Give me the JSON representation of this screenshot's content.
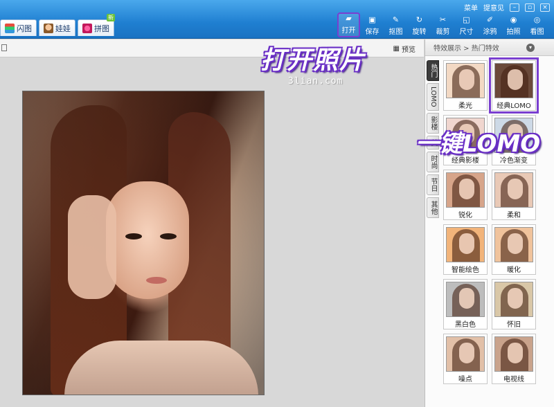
{
  "window": {
    "menu_label": "菜单",
    "feedback_label": "提意见",
    "minimize_icon": "minimize-icon",
    "restore_icon": "restore-icon",
    "close_icon": "close-icon"
  },
  "modules": [
    {
      "label": "闪图",
      "icon": "flash-icon"
    },
    {
      "label": "娃娃",
      "icon": "doll-icon"
    },
    {
      "label": "拼图",
      "icon": "puzzle-icon",
      "badge": "新"
    }
  ],
  "tools": [
    {
      "label": "打开",
      "icon": "folder-open-icon",
      "active": true
    },
    {
      "label": "保存",
      "icon": "save-icon"
    },
    {
      "label": "抠图",
      "icon": "cutout-icon"
    },
    {
      "label": "旋转",
      "icon": "rotate-icon"
    },
    {
      "label": "裁剪",
      "icon": "crop-icon"
    },
    {
      "label": "尺寸",
      "icon": "resize-icon"
    },
    {
      "label": "涂鸦",
      "icon": "brush-icon"
    },
    {
      "label": "拍照",
      "icon": "camera-icon"
    },
    {
      "label": "看图",
      "icon": "view-icon"
    }
  ],
  "subbar": {
    "preview_label": "预览"
  },
  "annotations": {
    "open_photo": "打开照片",
    "one_click_lomo": "一键LOMO",
    "watermark": "3lian.com"
  },
  "panel": {
    "breadcrumb": "特效展示 > 热门特效",
    "categories": [
      "热门",
      "LOMO",
      "影楼",
      "美",
      "时尚",
      "节日",
      "其他"
    ],
    "effects": [
      {
        "label": "柔光",
        "tint": "#f3d9c4"
      },
      {
        "label": "经典LOMO",
        "tint": "#6b4a3a",
        "highlight": true
      },
      {
        "label": "经典影楼",
        "tint": "#f0d6cf"
      },
      {
        "label": "冷色渐变",
        "tint": "#cdd9e6"
      },
      {
        "label": "锐化",
        "tint": "#d7a58a"
      },
      {
        "label": "柔和",
        "tint": "#e9c9b6"
      },
      {
        "label": "智能绘色",
        "tint": "#f2b47a"
      },
      {
        "label": "暖化",
        "tint": "#f0c39c"
      },
      {
        "label": "黑白色",
        "tint": "#bdbdbd"
      },
      {
        "label": "怀旧",
        "tint": "#d9c7a7"
      },
      {
        "label": "噪点",
        "tint": "#e2c0a8"
      },
      {
        "label": "电视线",
        "tint": "#c9a38c"
      }
    ]
  }
}
